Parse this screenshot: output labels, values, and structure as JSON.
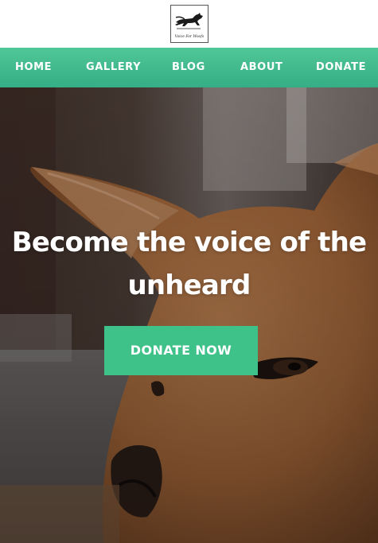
{
  "logo": {
    "caption": "Voice For Woofs",
    "icon": "running-dog-icon"
  },
  "nav": {
    "items": [
      {
        "label": "HOME"
      },
      {
        "label": "GALLERY"
      },
      {
        "label": "BLOG"
      },
      {
        "label": "ABOUT"
      },
      {
        "label": "DONATE"
      }
    ]
  },
  "hero": {
    "title_line1": "Become the voice of the",
    "title_line2": "unheard",
    "button_label": "DONATE NOW"
  },
  "colors": {
    "nav_top": "#4fc797",
    "nav_bottom": "#36ae86",
    "button": "#3ec28a",
    "text_on_brand": "#ffffff"
  }
}
